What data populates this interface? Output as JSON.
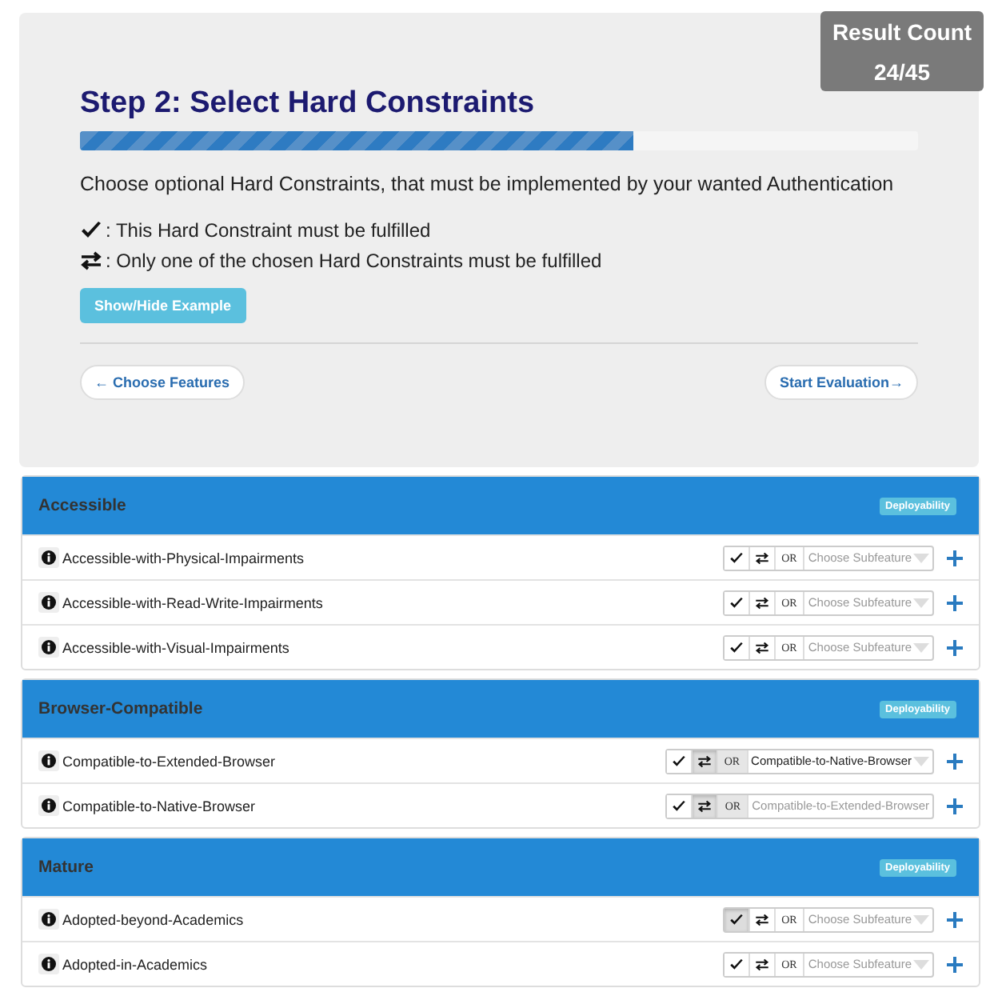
{
  "result_count": {
    "label": "Result Count",
    "value": "24/45"
  },
  "step": {
    "title": "Step 2: Select Hard Constraints",
    "progress": {
      "level": 0.66
    },
    "description": "Choose optional Hard Constraints, that must be implemented by your wanted Authentication",
    "legend": [
      {
        "kind": "check",
        "text": ": This Hard Constraint must be fulfilled"
      },
      {
        "kind": "exchange",
        "text": ": Only one of the chosen Hard Constraints must be fulfilled"
      }
    ],
    "example_button": "Show/Hide Example",
    "back_button": "← Choose Features",
    "next_button": "Start Evaluation→"
  },
  "groups": [
    {
      "title": "Accessible",
      "badge": "Deployability",
      "rows": [
        {
          "name": "Accessible-with-Physical-Impairments",
          "must": false,
          "or": false,
          "or_label": "OR",
          "subfeature": {
            "placeholder": "Choose Subfeature",
            "disabled": false
          }
        },
        {
          "name": "Accessible-with-Read-Write-Impairments",
          "must": false,
          "or": false,
          "or_label": "OR",
          "subfeature": {
            "placeholder": "Choose Subfeature",
            "disabled": false
          }
        },
        {
          "name": "Accessible-with-Visual-Impairments",
          "must": false,
          "or": false,
          "or_label": "OR",
          "subfeature": {
            "placeholder": "Choose Subfeature",
            "disabled": false
          }
        }
      ]
    },
    {
      "title": "Browser-Compatible",
      "badge": "Deployability",
      "rows": [
        {
          "name": "Compatible-to-Extended-Browser",
          "must": false,
          "or": true,
          "or_label": "OR",
          "subfeature": {
            "value": "Compatible-to-Native-Browser",
            "disabled": false
          }
        },
        {
          "name": "Compatible-to-Native-Browser",
          "must": false,
          "or": true,
          "or_label": "OR",
          "subfeature": {
            "value": "Compatible-to-Extended-Browser",
            "disabled": true
          }
        }
      ]
    },
    {
      "title": "Mature",
      "badge": "Deployability",
      "rows": [
        {
          "name": "Adopted-beyond-Academics",
          "must": true,
          "or": false,
          "or_label": "OR",
          "subfeature": {
            "placeholder": "Choose Subfeature",
            "disabled": false
          }
        },
        {
          "name": "Adopted-in-Academics",
          "must": false,
          "or": false,
          "or_label": "OR",
          "subfeature": {
            "placeholder": "Choose Subfeature",
            "disabled": false
          }
        }
      ]
    }
  ]
}
